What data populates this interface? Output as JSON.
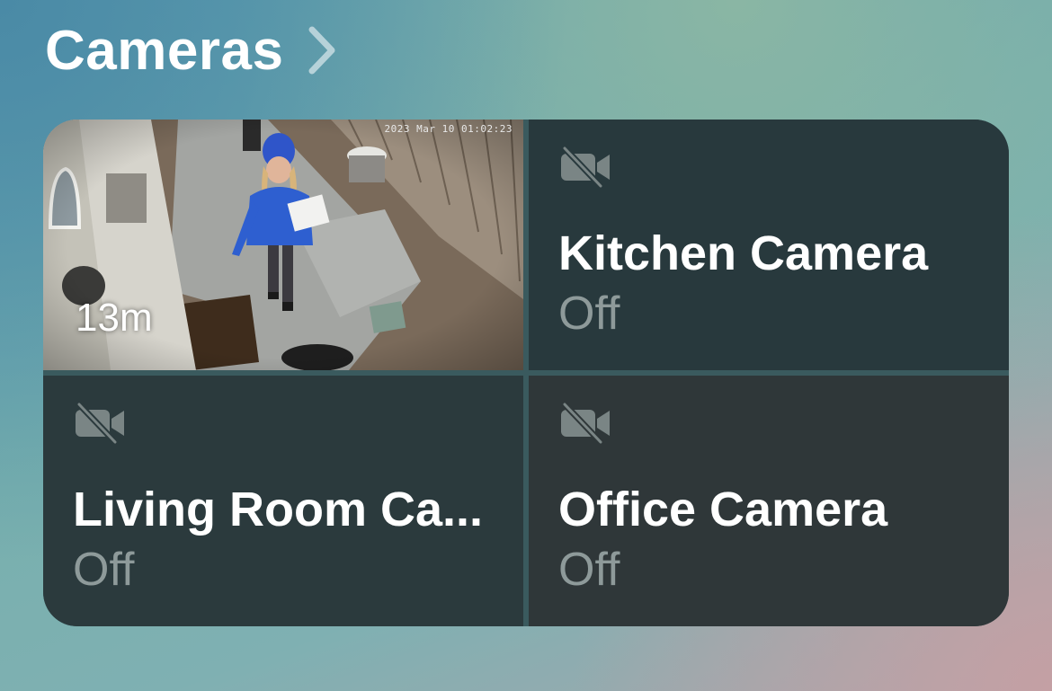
{
  "section": {
    "title": "Cameras",
    "chevron_icon": "chevron-right-icon"
  },
  "cameras": [
    {
      "name": "",
      "snapshot_age": "13m",
      "overlay_timestamp": "2023 Mar 10 01:02:23"
    },
    {
      "name": "Kitchen Camera",
      "status": "Off",
      "icon": "camera-off-icon"
    },
    {
      "name": "Living Room Ca...",
      "status": "Off",
      "icon": "camera-off-icon"
    },
    {
      "name": "Office Camera",
      "status": "Off",
      "icon": "camera-off-icon"
    }
  ],
  "colors": {
    "tile_background": "#28393d",
    "status_text": "#8e9a9a",
    "title_text": "#ffffff"
  }
}
